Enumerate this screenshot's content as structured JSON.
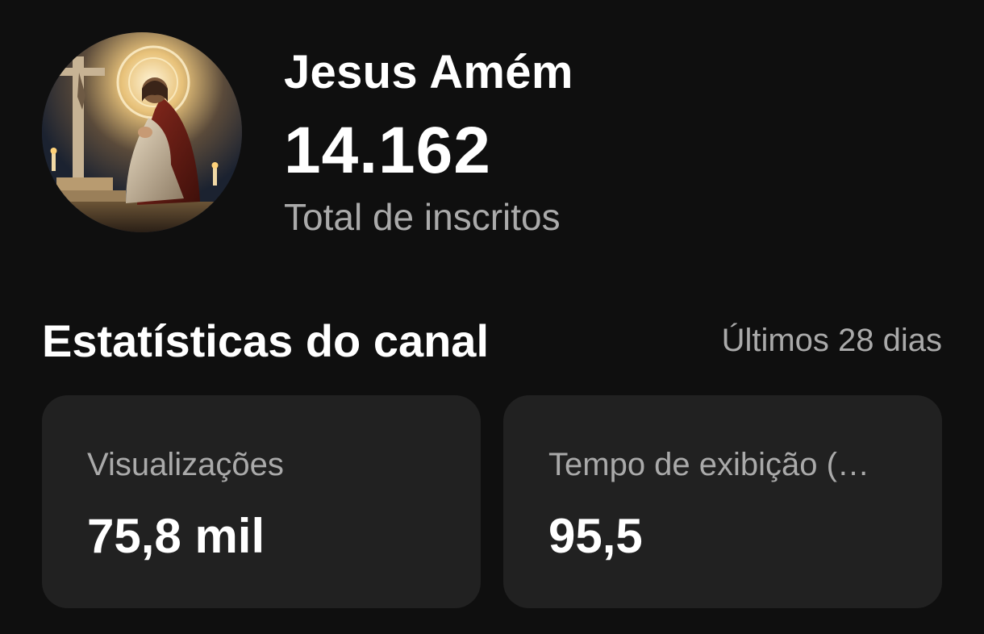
{
  "channel": {
    "name": "Jesus Amém",
    "subscribers": "14.162",
    "subscribers_label": "Total de inscritos",
    "avatar": "praying-jesus-avatar"
  },
  "stats": {
    "title": "Estatísticas do canal",
    "period": "Últimos 28 dias",
    "cards": [
      {
        "label": "Visualizações",
        "value": "75,8 mil"
      },
      {
        "label": "Tempo de exibição (…",
        "value": "95,5"
      }
    ]
  },
  "colors": {
    "background": "#0f0f0f",
    "card": "#212121",
    "primary_text": "#ffffff",
    "secondary_text": "#aaaaaa"
  }
}
